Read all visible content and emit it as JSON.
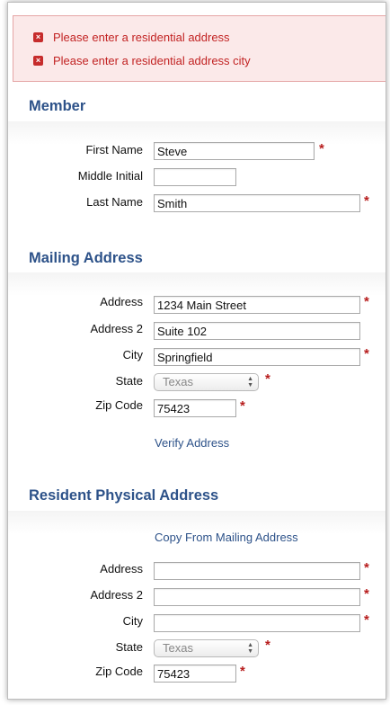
{
  "errors": [
    {
      "icon": "error-icon",
      "text": "Please enter a residential address"
    },
    {
      "icon": "error-icon",
      "text": "Please enter a residential address city"
    }
  ],
  "member": {
    "title": "Member",
    "first_name": {
      "label": "First Name",
      "value": "Steve",
      "required": "*"
    },
    "middle_initial": {
      "label": "Middle Initial",
      "value": ""
    },
    "last_name": {
      "label": "Last Name",
      "value": "Smith",
      "required": "*"
    }
  },
  "mailing": {
    "title": "Mailing Address",
    "address": {
      "label": "Address",
      "value": "1234 Main Street",
      "required": "*"
    },
    "address2": {
      "label": "Address 2",
      "value": "Suite 102"
    },
    "city": {
      "label": "City",
      "value": "Springfield",
      "required": "*"
    },
    "state": {
      "label": "State",
      "value": "Texas",
      "required": "*"
    },
    "zip": {
      "label": "Zip Code",
      "value": "75423",
      "required": "*"
    },
    "verify_link": "Verify Address"
  },
  "resident": {
    "title": "Resident Physical Address",
    "copy_link": "Copy From Mailing Address",
    "address": {
      "label": "Address",
      "value": "",
      "required": "*"
    },
    "address2": {
      "label": "Address 2",
      "value": "",
      "required": "*"
    },
    "city": {
      "label": "City",
      "value": "",
      "required": "*"
    },
    "state": {
      "label": "State",
      "value": "Texas",
      "required": "*"
    },
    "zip": {
      "label": "Zip Code",
      "value": "75423",
      "required": "*"
    }
  },
  "colors": {
    "heading": "#2d5289",
    "error_text": "#c22323",
    "error_bg": "#fbe9e9",
    "required": "#b71c1c"
  }
}
